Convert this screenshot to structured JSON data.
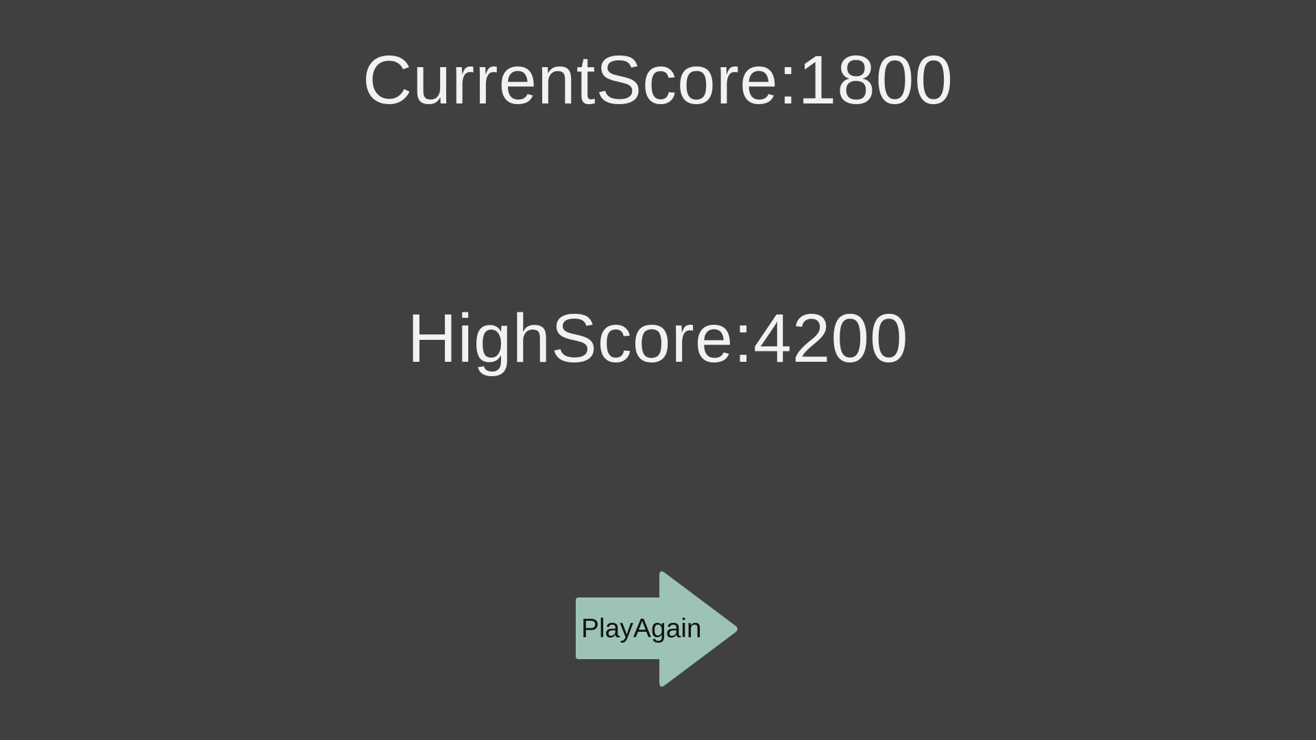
{
  "hud": {
    "current_score": "CurrentScore:1800",
    "high_score": "HighScore:4200"
  },
  "play_again_button": {
    "label": "PlayAgain",
    "icon": "right-arrow-icon",
    "color": "#9dc3b6"
  },
  "colors": {
    "background": "#404040",
    "score_text": "#f2f2f2",
    "button_text": "#111111"
  }
}
